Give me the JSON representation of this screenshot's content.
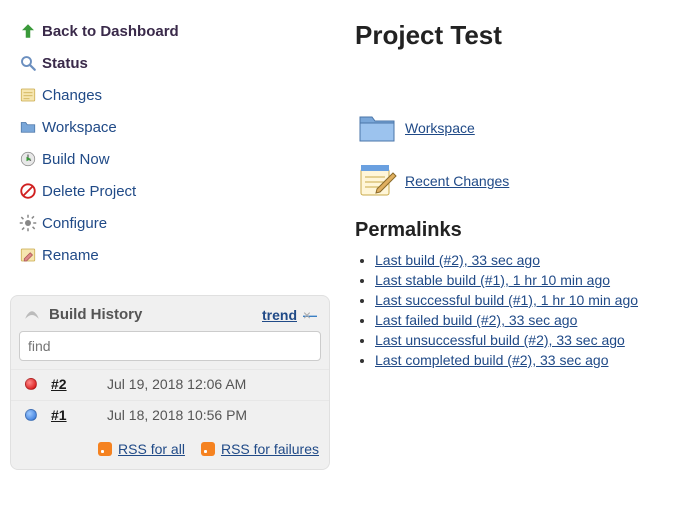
{
  "sidebar": {
    "items": [
      {
        "label": "Back to Dashboard",
        "icon": "up-arrow-icon"
      },
      {
        "label": "Status",
        "icon": "search-icon"
      },
      {
        "label": "Changes",
        "icon": "notes-icon"
      },
      {
        "label": "Workspace",
        "icon": "folder-icon"
      },
      {
        "label": "Build Now",
        "icon": "clock-play-icon"
      },
      {
        "label": "Delete Project",
        "icon": "no-entry-icon"
      },
      {
        "label": "Configure",
        "icon": "gear-icon"
      },
      {
        "label": "Rename",
        "icon": "rename-icon"
      }
    ]
  },
  "history": {
    "title": "Build History",
    "trend_label": "trend",
    "collapse_glyph": "—",
    "find_placeholder": "find",
    "builds": [
      {
        "number": "#2",
        "timestamp": "Jul 19, 2018 12:06 AM",
        "status": "red"
      },
      {
        "number": "#1",
        "timestamp": "Jul 18, 2018 10:56 PM",
        "status": "blue"
      }
    ],
    "rss_all": "RSS for all",
    "rss_failures": "RSS for failures"
  },
  "main": {
    "title": "Project Test",
    "links": [
      {
        "label": "Workspace",
        "icon": "folder-large-icon"
      },
      {
        "label": "Recent Changes",
        "icon": "notepad-pencil-icon"
      }
    ],
    "permalinks_title": "Permalinks",
    "permalinks": [
      "Last build (#2), 33 sec ago",
      "Last stable build (#1), 1 hr 10 min ago",
      "Last successful build (#1), 1 hr 10 min ago",
      "Last failed build (#2), 33 sec ago",
      "Last unsuccessful build (#2), 33 sec ago",
      "Last completed build (#2), 33 sec ago"
    ]
  }
}
